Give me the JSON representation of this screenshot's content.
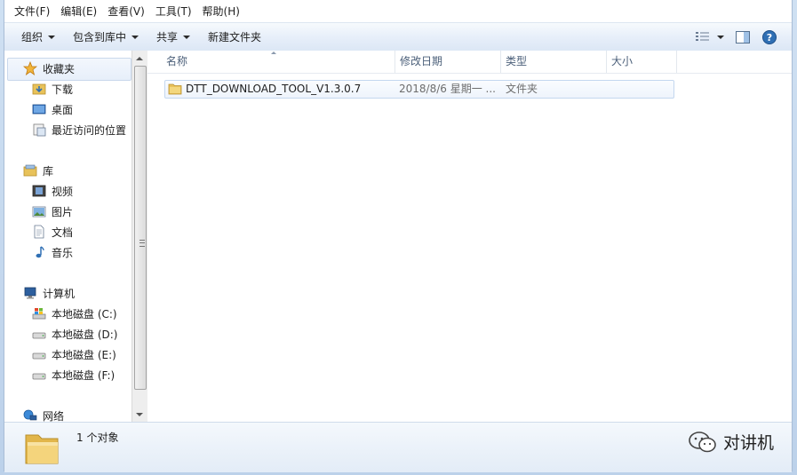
{
  "menu": [
    "文件(F)",
    "编辑(E)",
    "查看(V)",
    "工具(T)",
    "帮助(H)"
  ],
  "toolbar": {
    "organize": "组织",
    "include_in_library": "包含到库中",
    "share": "共享",
    "new_folder": "新建文件夹"
  },
  "nav": {
    "favorites": "收藏夹",
    "downloads": "下载",
    "desktop": "桌面",
    "recent": "最近访问的位置",
    "libraries": "库",
    "videos": "视频",
    "pictures": "图片",
    "documents": "文档",
    "music": "音乐",
    "computer": "计算机",
    "drive_c": "本地磁盘 (C:)",
    "drive_d": "本地磁盘 (D:)",
    "drive_e": "本地磁盘 (E:)",
    "drive_f": "本地磁盘 (F:)",
    "network": "网络"
  },
  "columns": {
    "name": "名称",
    "modified": "修改日期",
    "type": "类型",
    "size": "大小"
  },
  "files": [
    {
      "name": "DTT_DOWNLOAD_TOOL_V1.3.0.7",
      "modified": "2018/8/6 星期一 ...",
      "type": "文件夹",
      "size": ""
    }
  ],
  "status": {
    "count": "1 个对象"
  },
  "watermark": "对讲机",
  "colors": {
    "folder": "#e8c25a",
    "accent": "#2f6fb4",
    "header_text": "#4c607a"
  }
}
